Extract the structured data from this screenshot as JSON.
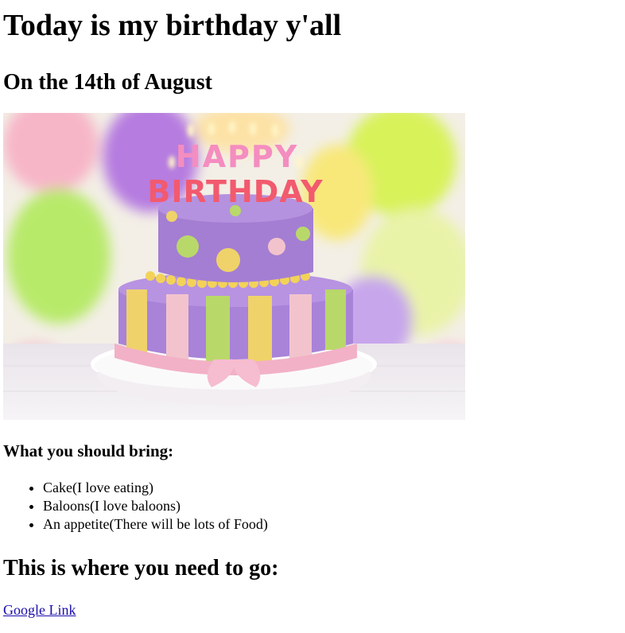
{
  "heading": "Today is my birthday y'all",
  "date_line": "On the 14th of August",
  "image": {
    "topper_top": "HAPPY",
    "topper_bottom": "BIRTHDAY",
    "alt": "birthday cake"
  },
  "bring": {
    "title": "What you should bring:",
    "items": [
      "Cake(I love eating)",
      "Baloons(I love baloons)",
      "An appetite(There will be lots of Food)"
    ]
  },
  "location": {
    "title": "This is where you need to go:",
    "link_text": "Google Link"
  },
  "colors": {
    "link": "#1a0dab"
  }
}
